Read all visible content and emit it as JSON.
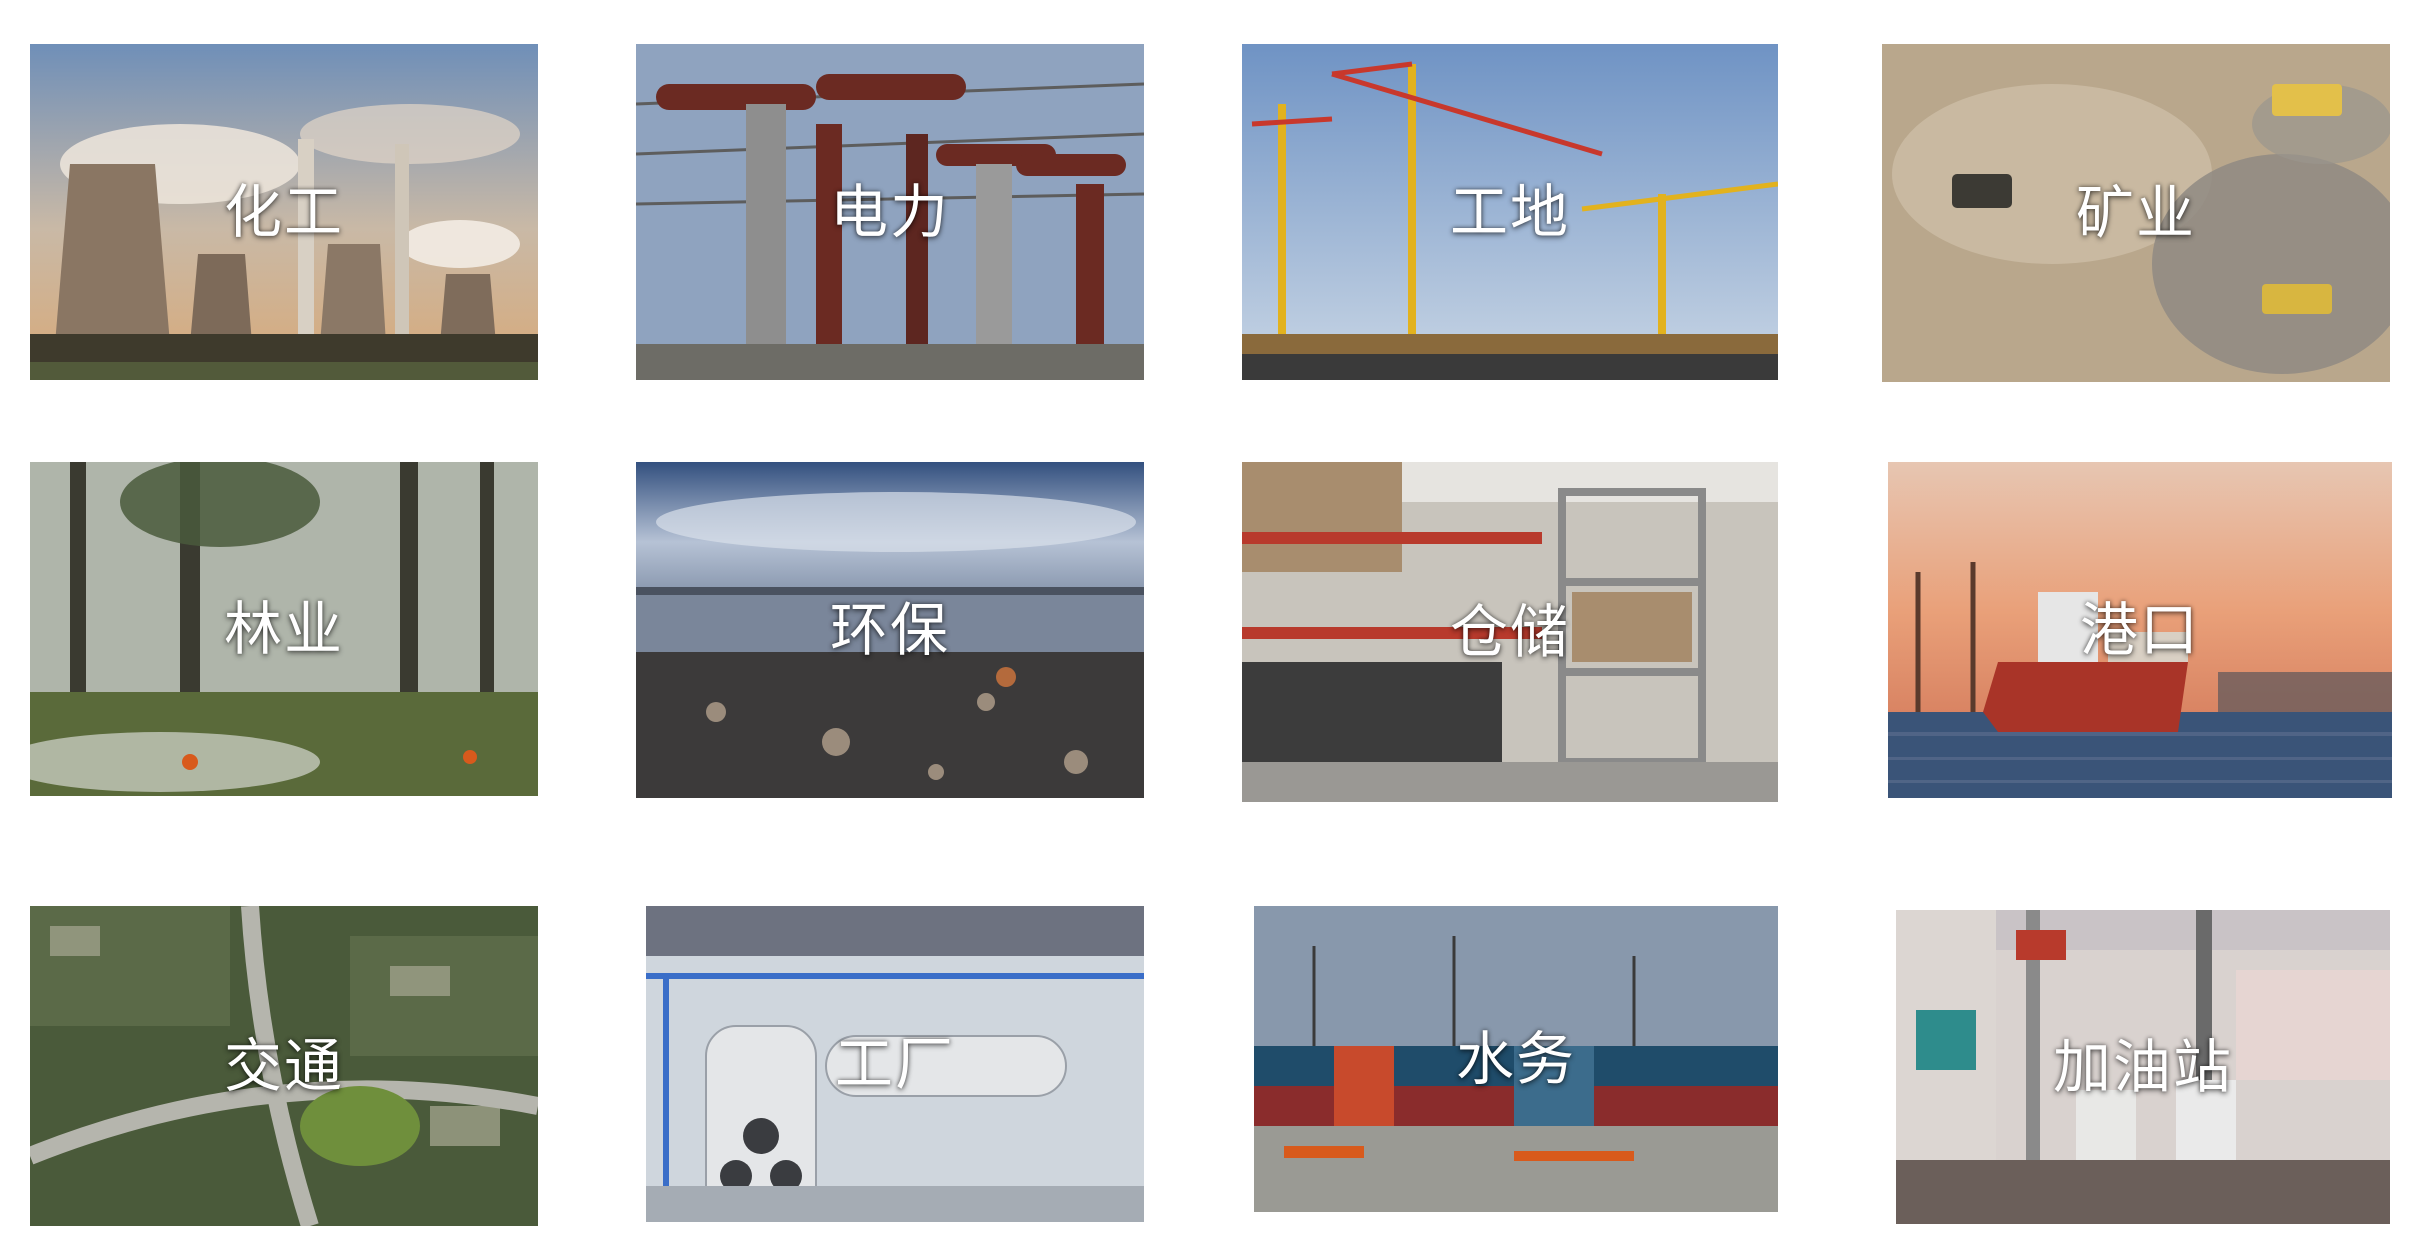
{
  "industries": [
    {
      "label": "化工"
    },
    {
      "label": "电力"
    },
    {
      "label": "工地"
    },
    {
      "label": "矿业"
    },
    {
      "label": "林业"
    },
    {
      "label": "环保"
    },
    {
      "label": "仓储"
    },
    {
      "label": "港口"
    },
    {
      "label": "交通"
    },
    {
      "label": "工厂"
    },
    {
      "label": "水务"
    },
    {
      "label": "加油站"
    }
  ]
}
